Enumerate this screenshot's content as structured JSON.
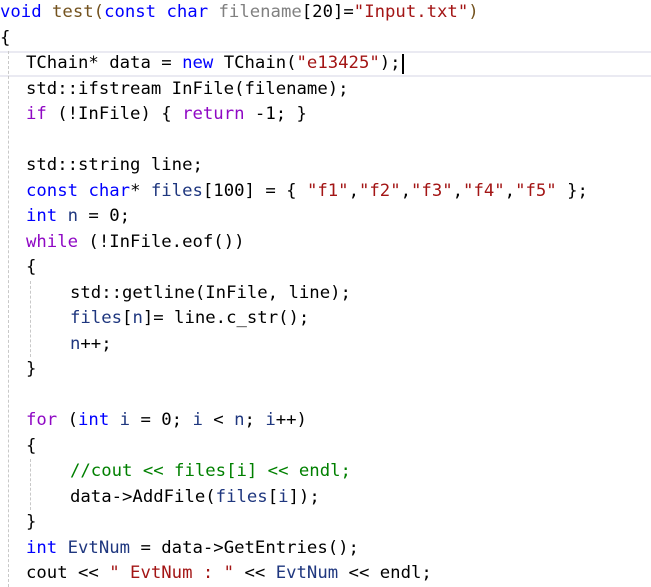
{
  "editor": {
    "language": "cpp",
    "current_line": 3,
    "colors": {
      "keyword": "#0000ff",
      "control": "#8f08c4",
      "string": "#a31515",
      "comment": "#008000",
      "function": "#74531f",
      "parameter": "#808080",
      "local": "#1f377f",
      "plain": "#000000"
    },
    "lines": [
      {
        "indent": 0,
        "tokens": [
          {
            "t": "void",
            "c": "kw"
          },
          {
            "t": " ",
            "c": "plain"
          },
          {
            "t": "test(",
            "c": "fn"
          },
          {
            "t": "const",
            "c": "kw"
          },
          {
            "t": " ",
            "c": "plain"
          },
          {
            "t": "char",
            "c": "kw"
          },
          {
            "t": " ",
            "c": "plain"
          },
          {
            "t": "filename",
            "c": "param"
          },
          {
            "t": "[20]=",
            "c": "plain"
          },
          {
            "t": "\"Input.txt\"",
            "c": "str"
          },
          {
            "t": ")",
            "c": "fn"
          }
        ]
      },
      {
        "indent": 0,
        "tokens": [
          {
            "t": "{",
            "c": "plain"
          }
        ]
      },
      {
        "indent": 1,
        "tokens": [
          {
            "t": "TChain* ",
            "c": "plain"
          },
          {
            "t": "data",
            "c": "plain"
          },
          {
            "t": " = ",
            "c": "plain"
          },
          {
            "t": "new",
            "c": "kw"
          },
          {
            "t": " TChain(",
            "c": "plain"
          },
          {
            "t": "\"e13425\"",
            "c": "str"
          },
          {
            "t": ");",
            "c": "plain"
          }
        ]
      },
      {
        "indent": 1,
        "tokens": [
          {
            "t": "std::ifstream InFile(",
            "c": "plain"
          },
          {
            "t": "filename",
            "c": "plain"
          },
          {
            "t": ");",
            "c": "plain"
          }
        ]
      },
      {
        "indent": 1,
        "tokens": [
          {
            "t": "if",
            "c": "ctl"
          },
          {
            "t": " (!InFile) { ",
            "c": "plain"
          },
          {
            "t": "return",
            "c": "ctl"
          },
          {
            "t": " -1; }",
            "c": "plain"
          }
        ]
      },
      {
        "indent": 1,
        "tokens": []
      },
      {
        "indent": 1,
        "tokens": [
          {
            "t": "std::string line;",
            "c": "plain"
          }
        ]
      },
      {
        "indent": 1,
        "tokens": [
          {
            "t": "const",
            "c": "kw"
          },
          {
            "t": " ",
            "c": "plain"
          },
          {
            "t": "char",
            "c": "kw"
          },
          {
            "t": "* ",
            "c": "plain"
          },
          {
            "t": "files",
            "c": "var"
          },
          {
            "t": "[100] = { ",
            "c": "plain"
          },
          {
            "t": "\"f1\"",
            "c": "str"
          },
          {
            "t": ",",
            "c": "plain"
          },
          {
            "t": "\"f2\"",
            "c": "str"
          },
          {
            "t": ",",
            "c": "plain"
          },
          {
            "t": "\"f3\"",
            "c": "str"
          },
          {
            "t": ",",
            "c": "plain"
          },
          {
            "t": "\"f4\"",
            "c": "str"
          },
          {
            "t": ",",
            "c": "plain"
          },
          {
            "t": "\"f5\"",
            "c": "str"
          },
          {
            "t": " };",
            "c": "plain"
          }
        ]
      },
      {
        "indent": 1,
        "tokens": [
          {
            "t": "int",
            "c": "kw"
          },
          {
            "t": " ",
            "c": "plain"
          },
          {
            "t": "n",
            "c": "var"
          },
          {
            "t": " = 0;",
            "c": "plain"
          }
        ]
      },
      {
        "indent": 1,
        "tokens": [
          {
            "t": "while",
            "c": "ctl"
          },
          {
            "t": " (!InFile.eof())",
            "c": "plain"
          }
        ]
      },
      {
        "indent": 1,
        "tokens": [
          {
            "t": "{",
            "c": "plain"
          }
        ]
      },
      {
        "indent": 2,
        "tokens": [
          {
            "t": "std::getline(InFile, line);",
            "c": "plain"
          }
        ]
      },
      {
        "indent": 2,
        "tokens": [
          {
            "t": "files",
            "c": "var"
          },
          {
            "t": "[",
            "c": "plain"
          },
          {
            "t": "n",
            "c": "var"
          },
          {
            "t": "]= line.c_str();",
            "c": "plain"
          }
        ]
      },
      {
        "indent": 2,
        "tokens": [
          {
            "t": "n",
            "c": "var"
          },
          {
            "t": "++;",
            "c": "plain"
          }
        ]
      },
      {
        "indent": 1,
        "tokens": [
          {
            "t": "}",
            "c": "plain"
          }
        ]
      },
      {
        "indent": 1,
        "tokens": []
      },
      {
        "indent": 1,
        "tokens": [
          {
            "t": "for",
            "c": "ctl"
          },
          {
            "t": " (",
            "c": "plain"
          },
          {
            "t": "int",
            "c": "kw"
          },
          {
            "t": " ",
            "c": "plain"
          },
          {
            "t": "i",
            "c": "var"
          },
          {
            "t": " = 0; ",
            "c": "plain"
          },
          {
            "t": "i",
            "c": "var"
          },
          {
            "t": " < ",
            "c": "plain"
          },
          {
            "t": "n",
            "c": "var"
          },
          {
            "t": "; ",
            "c": "plain"
          },
          {
            "t": "i",
            "c": "var"
          },
          {
            "t": "++)",
            "c": "plain"
          }
        ]
      },
      {
        "indent": 1,
        "tokens": [
          {
            "t": "{",
            "c": "plain"
          }
        ]
      },
      {
        "indent": 2,
        "tokens": [
          {
            "t": "//cout << files[i] << endl;",
            "c": "cmt"
          }
        ]
      },
      {
        "indent": 2,
        "tokens": [
          {
            "t": "data->AddFile(",
            "c": "plain"
          },
          {
            "t": "files",
            "c": "var"
          },
          {
            "t": "[",
            "c": "plain"
          },
          {
            "t": "i",
            "c": "var"
          },
          {
            "t": "]);",
            "c": "plain"
          }
        ]
      },
      {
        "indent": 1,
        "tokens": [
          {
            "t": "}",
            "c": "plain"
          }
        ]
      },
      {
        "indent": 1,
        "tokens": [
          {
            "t": "int",
            "c": "kw"
          },
          {
            "t": " ",
            "c": "plain"
          },
          {
            "t": "EvtNum",
            "c": "var"
          },
          {
            "t": " = data->GetEntries();",
            "c": "plain"
          }
        ]
      },
      {
        "indent": 1,
        "tokens": [
          {
            "t": "cout << ",
            "c": "plain"
          },
          {
            "t": "\" EvtNum : \"",
            "c": "str"
          },
          {
            "t": " << ",
            "c": "plain"
          },
          {
            "t": "EvtNum",
            "c": "var"
          },
          {
            "t": " << endl;",
            "c": "plain"
          }
        ]
      }
    ]
  }
}
